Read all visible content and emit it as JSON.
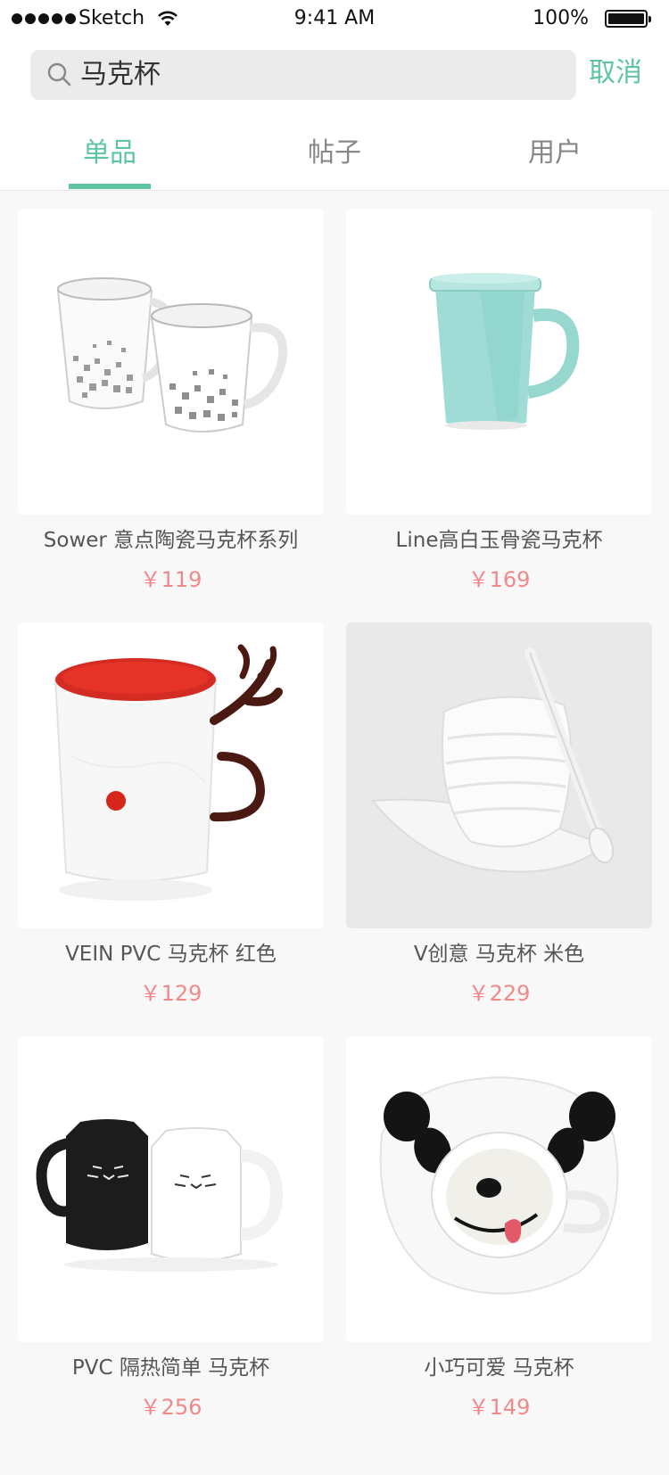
{
  "status_bar": {
    "carrier": "Sketch",
    "time": "9:41 AM",
    "battery": "100%"
  },
  "search": {
    "query": "马克杯",
    "cancel_label": "取消"
  },
  "tabs": [
    {
      "label": "单品",
      "active": true
    },
    {
      "label": "帖子",
      "active": false
    },
    {
      "label": "用户",
      "active": false
    }
  ],
  "accent_color": "#5ec5a3",
  "price_color": "#f08a8a",
  "products": [
    {
      "name": "Sower 意点陶瓷马克杯系列",
      "price": "￥119",
      "image": "white-mugs-pair"
    },
    {
      "name": "Line高白玉骨瓷马克杯",
      "price": "￥169",
      "image": "mint-mug-with-lid"
    },
    {
      "name": "VEIN PVC 马克杯 红色",
      "price": "￥129",
      "image": "red-antler-mug"
    },
    {
      "name": "V创意 马克杯 米色",
      "price": "￥229",
      "image": "white-cup-with-spoon"
    },
    {
      "name": "PVC 隔热简单 马克杯",
      "price": "￥256",
      "image": "cat-mugs-pair"
    },
    {
      "name": "小巧可爱 马克杯",
      "price": "￥149",
      "image": "panda-cup"
    }
  ]
}
